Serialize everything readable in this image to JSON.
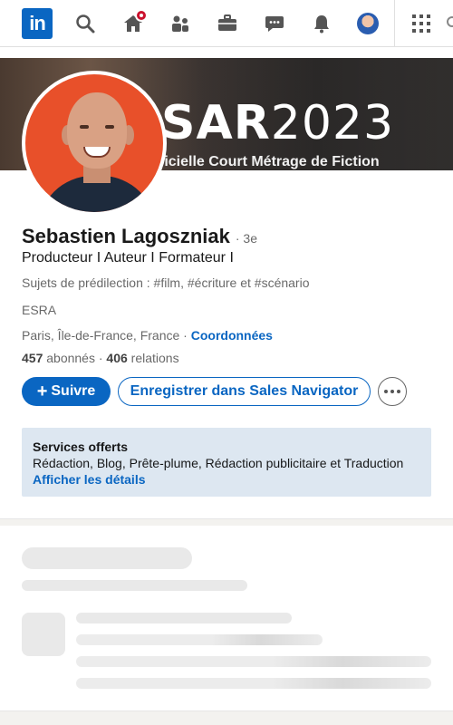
{
  "nav": {
    "logo": "in",
    "items": [
      {
        "name": "search-icon"
      },
      {
        "name": "home-icon",
        "has_notification": true
      },
      {
        "name": "network-icon"
      },
      {
        "name": "jobs-icon"
      },
      {
        "name": "messaging-icon"
      },
      {
        "name": "notifications-icon"
      },
      {
        "name": "me-avatar"
      },
      {
        "name": "apps-grid-icon"
      }
    ]
  },
  "banner": {
    "title_bold": "SAR",
    "title_light": "2023",
    "subtitle": "ficielle Court Métrage de Fiction"
  },
  "profile": {
    "name": "Sebastien Lagoszniak",
    "degree": "· 3e",
    "headline": "Producteur I Auteur I Formateur I",
    "topics": "Sujets de prédilection : #film, #écriture et #scénario",
    "school": "ESRA",
    "location": "Paris, Île-de-France, France ·",
    "contact_link": "Coordonnées",
    "followers_count": "457",
    "followers_label": "abonnés",
    "relations_sep": "·",
    "relations_count": "406",
    "relations_label": "relations"
  },
  "actions": {
    "follow_plus": "+",
    "follow_label": "Suivre",
    "sales_nav_label": "Enregistrer dans Sales Navigator"
  },
  "services": {
    "title": "Services offerts",
    "list": "Rédaction, Blog, Prête-plume, Rédaction publicitaire et Traduction",
    "link": "Afficher les détails"
  },
  "colors": {
    "brand": "#0a66c2",
    "services_bg": "#dde7f1",
    "notification": "#cb112d"
  }
}
